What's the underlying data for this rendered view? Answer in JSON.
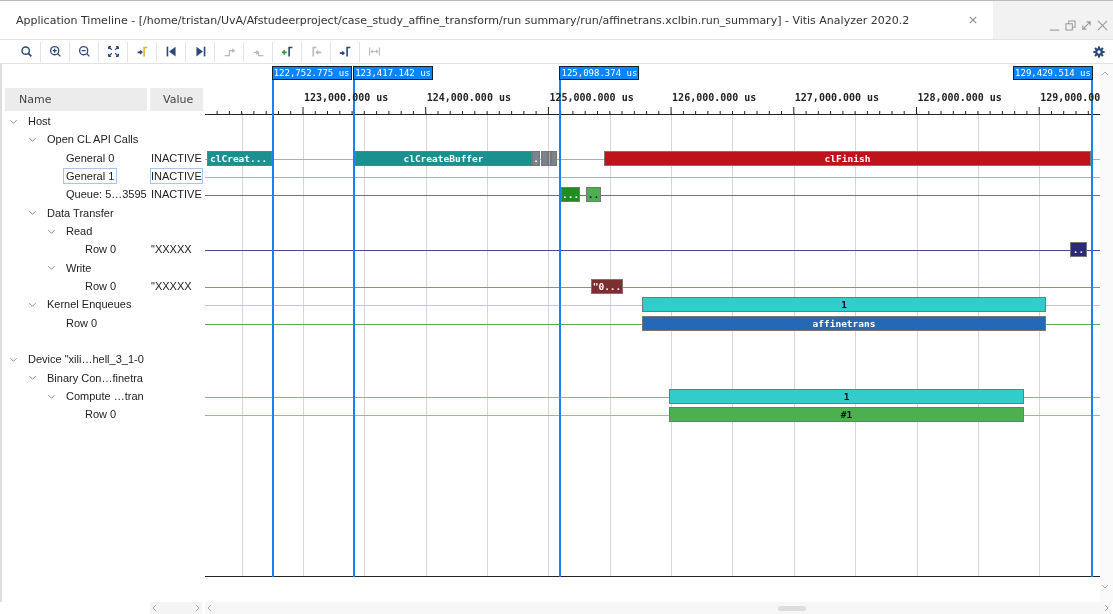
{
  "window": {
    "title": "Application Timeline - [/home/tristan/UvA/Afstudeerproject/case_study_affine_transform/run summary/run/affinetrans.xclbin.run_summary] - Vitis Analyzer 2020.2"
  },
  "toolbar": [
    {
      "kind": "search",
      "disabled": false
    },
    {
      "kind": "zoom-in",
      "disabled": false
    },
    {
      "kind": "zoom-out",
      "disabled": false
    },
    {
      "kind": "fit",
      "disabled": false
    },
    {
      "kind": "marker-to",
      "disabled": false
    },
    {
      "kind": "go-start",
      "disabled": false
    },
    {
      "kind": "go-end",
      "disabled": false
    },
    {
      "kind": "prev-edge",
      "disabled": true
    },
    {
      "kind": "next-edge",
      "disabled": true
    },
    {
      "kind": "add-marker",
      "disabled": false
    },
    {
      "kind": "prev-marker",
      "disabled": true
    },
    {
      "kind": "next-marker",
      "disabled": false
    },
    {
      "kind": "swap",
      "disabled": true
    }
  ],
  "columns": [
    "Name",
    "Value"
  ],
  "markers": [
    {
      "label": "122,752.775 us"
    },
    {
      "label": "123,417.142 us"
    },
    {
      "label": "125,098.374 us"
    },
    {
      "label": "129,429.514 us"
    }
  ],
  "ruler": [
    "123,000.000 us",
    "124,000.000 us",
    "125,000.000 us",
    "126,000.000 us",
    "127,000.000 us",
    "128,000.000 us",
    "129,000.00"
  ],
  "tree": [
    {
      "label": "Host",
      "expanded": true,
      "selected": false,
      "children": [
        {
          "label": "Open CL API Calls",
          "expanded": true,
          "selected": false,
          "children": [
            {
              "label": "General 0",
              "value": "INACTIVE",
              "selected": false,
              "trace": {
                "color": "#a8b0b8",
                "events": [
                  {
                    "label": "clCreat...",
                    "color": "#1b9090"
                  },
                  {
                    "label": "clCreateBuffer",
                    "color": "#1b9090"
                  },
                  {
                    "label": ".",
                    "color": "#7a8490"
                  },
                  {
                    "color": "#7a8490"
                  },
                  {
                    "color": "#e8a317"
                  },
                  {
                    "color": "#7a8490"
                  },
                  {
                    "label": "clFinish",
                    "color": "#c0121c"
                  }
                ]
              }
            },
            {
              "label": "General 1",
              "value": "INACTIVE",
              "selected": true,
              "trace": {
                "color": "#a8b0b8"
              }
            },
            {
              "label": "Queue: 5…3595",
              "value": "INACTIVE",
              "selected": false,
              "trace": {
                "color": "#6a7888",
                "events": [
                  {
                    "label": "...",
                    "color": "#228b22"
                  },
                  {
                    "label": "..",
                    "color": "#4caf50"
                  }
                ]
              }
            }
          ]
        },
        {
          "label": "Data Transfer",
          "expanded": true,
          "selected": false,
          "children": [
            {
              "label": "Read",
              "expanded": true,
              "selected": false,
              "children": [
                {
                  "label": "Row 0",
                  "value": "\"XXXXX",
                  "selected": false,
                  "trace": {
                    "color": "#4a4a9a",
                    "events": [
                      {
                        "label": "..",
                        "color": "#2a2a78"
                      }
                    ]
                  }
                }
              ]
            },
            {
              "label": "Write",
              "expanded": true,
              "selected": false,
              "children": [
                {
                  "label": "Row 0",
                  "value": "\"XXXXX",
                  "selected": false,
                  "trace": {
                    "color": "#c07878",
                    "events": [
                      {
                        "label": "\"0...",
                        "color": "#7b3030"
                      }
                    ]
                  }
                }
              ]
            }
          ]
        },
        {
          "label": "Kernel Enqueues",
          "expanded": true,
          "selected": false,
          "trace": {
            "color": "#88e0e0",
            "events": [
              {
                "label": "1",
                "color": "#33cccc"
              }
            ]
          },
          "children": [
            {
              "label": "Row 0",
              "selected": false,
              "trace": {
                "color": "#5aaa5a",
                "events": [
                  {
                    "label": "affinetrans",
                    "color": "#2468b8"
                  }
                ]
              }
            }
          ]
        }
      ]
    },
    {
      "label": "Device \"xili…hell_3_1-0",
      "expanded": true,
      "selected": false,
      "children": [
        {
          "label": "Binary Con…finetra",
          "expanded": true,
          "selected": false,
          "children": [
            {
              "label": "Compute …tran",
              "expanded": true,
              "selected": false,
              "trace": {
                "color": "#40d0d0",
                "events": [
                  {
                    "label": "1",
                    "color": "#33cccc"
                  }
                ]
              },
              "children": [
                {
                  "label": "Row 0",
                  "selected": false,
                  "trace": {
                    "color": "#80cc80",
                    "events": [
                      {
                        "label": "#1",
                        "color": "#4caf50"
                      }
                    ]
                  }
                }
              ]
            }
          ]
        }
      ]
    }
  ]
}
